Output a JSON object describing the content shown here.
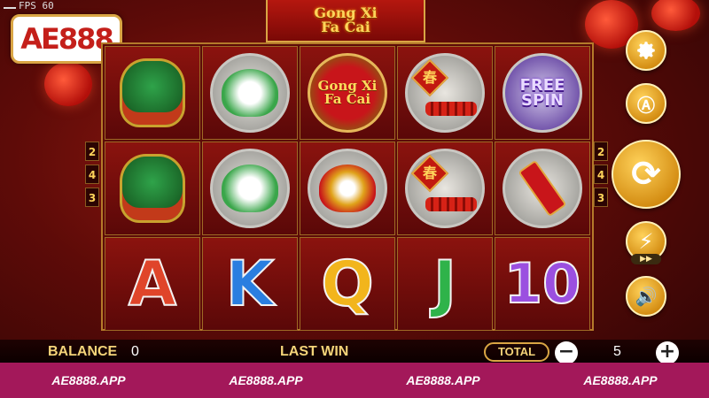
{
  "top": {
    "fps_label": "FPS 60",
    "title_line1": "Gong Xi",
    "title_line2": "Fa Cai"
  },
  "logo": {
    "text": "AE888"
  },
  "reels": {
    "row1": [
      {
        "symbol": "green-dragon"
      },
      {
        "symbol": "lion-dance-medal"
      },
      {
        "symbol": "gong-xi-fa-cai-coin",
        "text1": "Gong Xi",
        "text2": "Fa Cai"
      },
      {
        "symbol": "chun-firecracker",
        "char": "春"
      },
      {
        "symbol": "free-spin-god",
        "text1": "FREE",
        "text2": "SPIN"
      }
    ],
    "row2": [
      {
        "symbol": "green-dragon"
      },
      {
        "symbol": "lion-dance-medal"
      },
      {
        "symbol": "lion-head-medal"
      },
      {
        "symbol": "chun-firecracker",
        "char": "春"
      },
      {
        "symbol": "scroll-medal"
      }
    ],
    "row3": [
      {
        "symbol": "letter-a",
        "text": "A",
        "color": "#e0452a"
      },
      {
        "symbol": "letter-k",
        "text": "K",
        "color": "#2a7ee0"
      },
      {
        "symbol": "letter-q",
        "text": "Q",
        "color": "#f2b51c"
      },
      {
        "symbol": "letter-j",
        "text": "J",
        "color": "#2fb34a"
      },
      {
        "symbol": "number-10",
        "text": "10",
        "color": "#9b4fe0"
      }
    ]
  },
  "line_numbers_left": [
    "2",
    "4",
    "3"
  ],
  "line_numbers_right": [
    "2",
    "4",
    "3"
  ],
  "buttons": {
    "settings": "gear-icon",
    "auto": "auto-icon",
    "spin": "spin-icon",
    "turbo": "lightning-icon",
    "sound": "speaker-icon"
  },
  "bottom": {
    "balance_label": "BALANCE",
    "balance_value": "0",
    "last_win_label": "LAST WIN",
    "total_bet_label": "TOTAL BET",
    "bet_value": "5",
    "minus": "−",
    "plus": "+"
  },
  "promo": [
    "AE8888.APP",
    "AE8888.APP",
    "AE8888.APP",
    "AE8888.APP"
  ],
  "colors": {
    "accent": "#d9a544",
    "promo_bg": "#a3185a",
    "balance_label": "#f4d479"
  }
}
